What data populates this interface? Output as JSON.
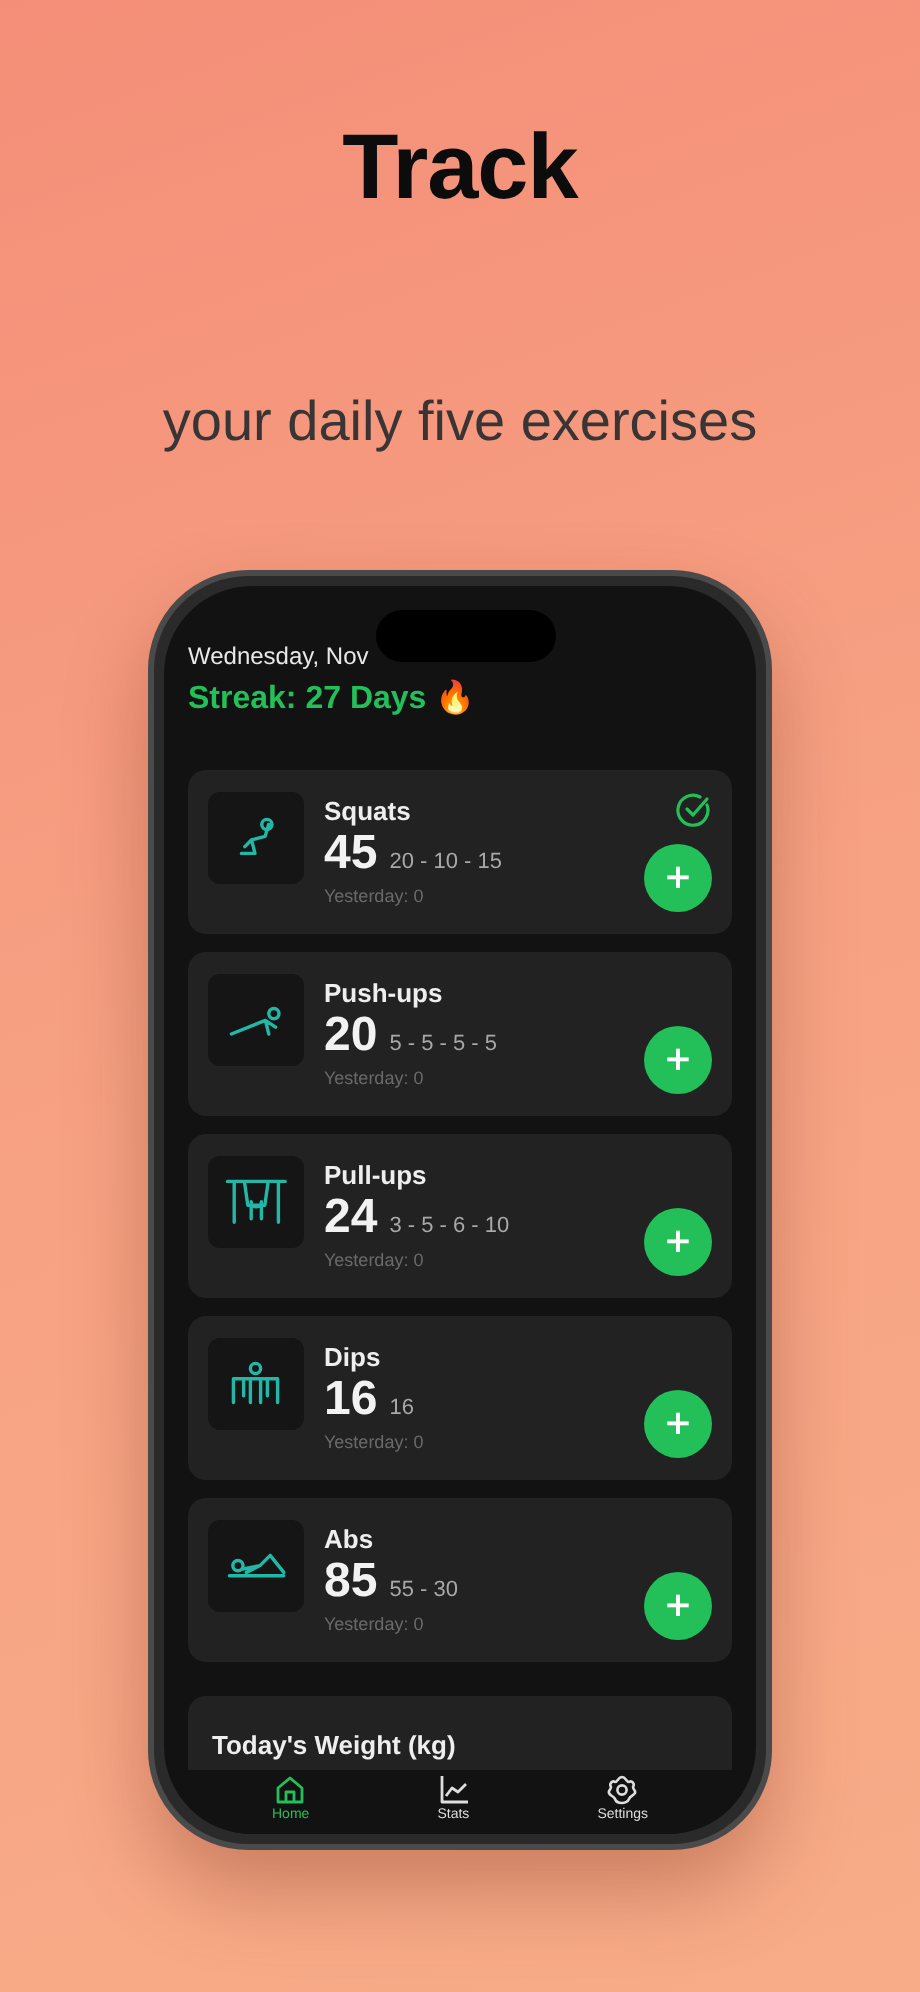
{
  "headline": "Track",
  "subtitle": "your daily five exercises",
  "screen": {
    "date": "Wednesday, Nov",
    "streak": "Streak: 27 Days 🔥",
    "exercises": [
      {
        "name": "Squats",
        "total": "45",
        "sets": "20 - 10 - 15",
        "yesterday": "Yesterday: 0",
        "completed": true,
        "add_label": "+"
      },
      {
        "name": "Push-ups",
        "total": "20",
        "sets": "5 - 5 - 5 - 5",
        "yesterday": "Yesterday: 0",
        "completed": false,
        "add_label": "+"
      },
      {
        "name": "Pull-ups",
        "total": "24",
        "sets": "3 - 5 - 6 - 10",
        "yesterday": "Yesterday: 0",
        "completed": false,
        "add_label": "+"
      },
      {
        "name": "Dips",
        "total": "16",
        "sets": "16",
        "yesterday": "Yesterday: 0",
        "completed": false,
        "add_label": "+"
      },
      {
        "name": "Abs",
        "total": "85",
        "sets": "55 - 30",
        "yesterday": "Yesterday: 0",
        "completed": false,
        "add_label": "+"
      }
    ],
    "weight_title": "Today's Weight (kg)",
    "tabs": [
      {
        "label": "Home",
        "kind": "home",
        "selected": true
      },
      {
        "label": "Stats",
        "kind": "stats",
        "selected": false
      },
      {
        "label": "Settings",
        "kind": "settings",
        "selected": false
      }
    ]
  }
}
